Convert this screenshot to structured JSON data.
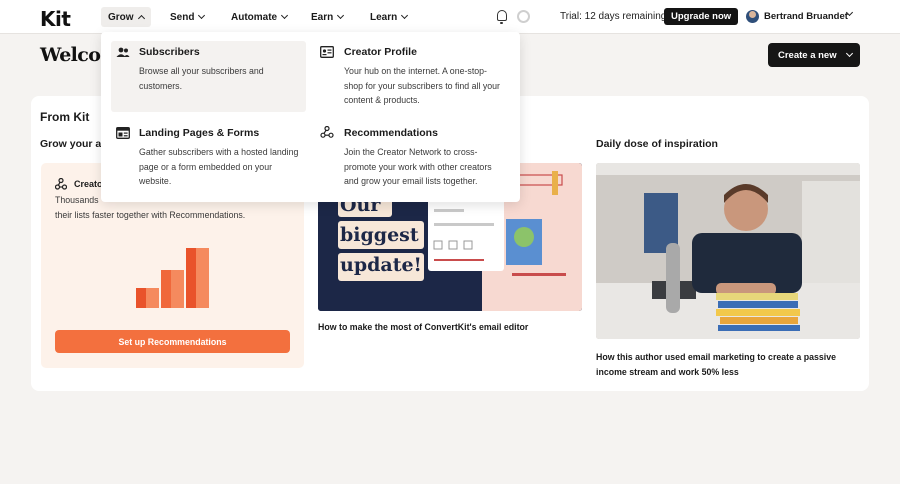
{
  "nav": {
    "logo": "Kit",
    "items": [
      {
        "label": "Grow"
      },
      {
        "label": "Send"
      },
      {
        "label": "Automate"
      },
      {
        "label": "Earn"
      },
      {
        "label": "Learn"
      }
    ],
    "trial_text": "Trial: 12 days remaining",
    "upgrade_label": "Upgrade now",
    "user_name": "Bertrand Bruandet"
  },
  "header": {
    "welcome": "Welcome",
    "create_label": "Create a new"
  },
  "main": {
    "section_title": "From Kit",
    "grow_title": "Grow your au",
    "daily_title": "Daily dose of inspiration",
    "promo": {
      "title": "Creato",
      "body_line1": "Thousands",
      "body_line2": "their lists faster together with Recommendations.",
      "button_label": "Set up Recommendations"
    },
    "article1": {
      "caption": "How to make the most of ConvertKit's email editor",
      "image_lines": [
        "Our",
        "biggest",
        "update!"
      ]
    },
    "article2": {
      "caption": "How this author used email marketing to create a passive income stream and work 50% less"
    }
  },
  "grow_menu": {
    "items": [
      {
        "title": "Subscribers",
        "desc_lines": [
          "Browse all your subscribers and",
          "customers."
        ]
      },
      {
        "title": "Creator Profile",
        "desc_lines": [
          "Your hub on the internet. A one-stop-",
          "shop for your subscribers to find all your",
          "content & products."
        ]
      },
      {
        "title": "Landing Pages & Forms",
        "desc_lines": [
          "Gather subscribers with a hosted landing",
          "page or a form embedded on your",
          "website."
        ]
      },
      {
        "title": "Recommendations",
        "desc_lines": [
          "Join the Creator Network to cross-",
          "promote your work with other creators",
          "and grow your email lists together."
        ]
      }
    ]
  },
  "colors": {
    "accent_orange": "#f3703e",
    "promo_bg": "#fdf2ea",
    "dark_button": "#141414"
  }
}
